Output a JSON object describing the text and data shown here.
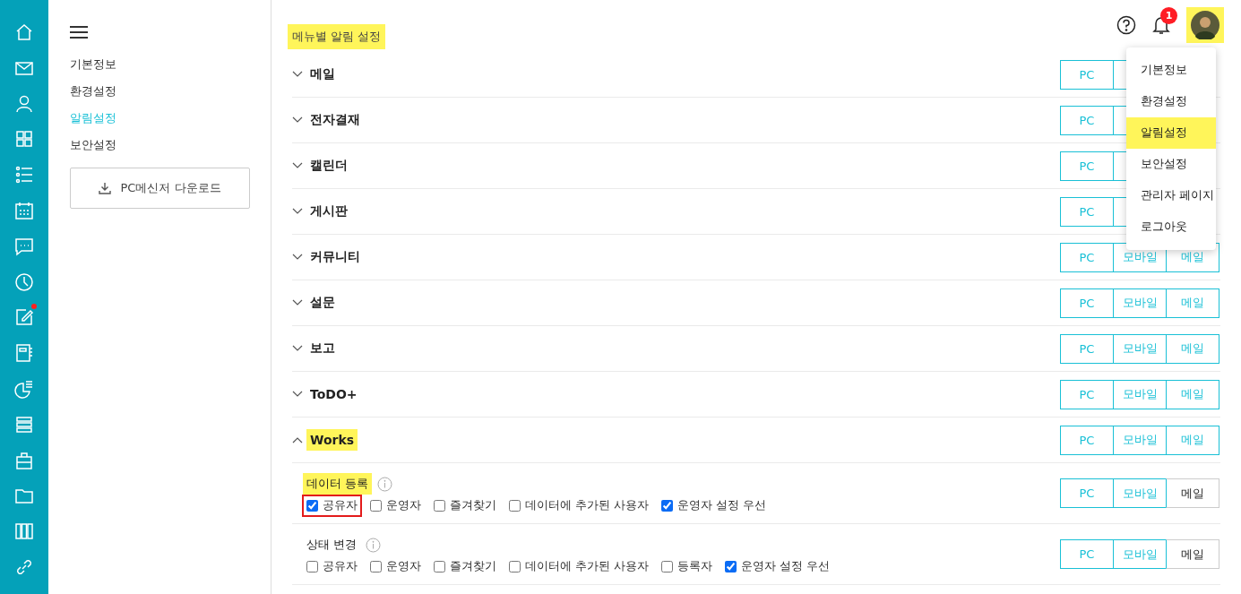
{
  "rail": [
    {
      "dot": false
    },
    {
      "dot": false
    },
    {
      "dot": false
    },
    {
      "dot": false
    },
    {
      "dot": false
    },
    {
      "dot": false
    },
    {
      "dot": false
    },
    {
      "dot": false
    },
    {
      "dot": true
    },
    {
      "dot": false
    },
    {
      "dot": false
    },
    {
      "dot": false
    },
    {
      "dot": false
    },
    {
      "dot": false
    },
    {
      "dot": false
    },
    {
      "dot": false
    }
  ],
  "sidebar": {
    "items": [
      {
        "label": "기본정보",
        "selected": false
      },
      {
        "label": "환경설정",
        "selected": false
      },
      {
        "label": "알림설정",
        "selected": true
      },
      {
        "label": "보안설정",
        "selected": false
      }
    ],
    "download_button": "PC메신저 다운로드"
  },
  "page_title": {
    "text": "메뉴별 알림 설정",
    "highlighted": true
  },
  "header": {
    "badge": "1",
    "avatar_highlighted": true
  },
  "sections": [
    {
      "name": "메일",
      "expanded": false,
      "highlighted": false,
      "channels": [
        {
          "label": "PC",
          "selected": true
        },
        {
          "selected": true
        }
      ]
    },
    {
      "name": "전자결재",
      "expanded": false,
      "highlighted": false,
      "channels": [
        {
          "label": "PC",
          "selected": true
        },
        {
          "selected": true
        }
      ]
    },
    {
      "name": "캘린더",
      "expanded": false,
      "highlighted": false,
      "channels": [
        {
          "label": "PC",
          "selected": true
        },
        {
          "selected": true
        }
      ]
    },
    {
      "name": "게시판",
      "expanded": false,
      "highlighted": false,
      "channels": [
        {
          "label": "PC",
          "selected": true
        },
        {
          "selected": true
        }
      ]
    },
    {
      "name": "커뮤니티",
      "expanded": false,
      "highlighted": false,
      "channels": [
        {
          "label": "PC",
          "selected": true
        },
        {
          "label": "모바일",
          "selected": true
        },
        {
          "label": "메일",
          "selected": true
        }
      ]
    },
    {
      "name": "설문",
      "expanded": false,
      "highlighted": false,
      "channels": [
        {
          "label": "PC",
          "selected": true
        },
        {
          "label": "모바일",
          "selected": true
        },
        {
          "label": "메일",
          "selected": true
        }
      ]
    },
    {
      "name": "보고",
      "expanded": false,
      "highlighted": false,
      "channels": [
        {
          "label": "PC",
          "selected": true
        },
        {
          "label": "모바일",
          "selected": true
        },
        {
          "label": "메일",
          "selected": true
        }
      ]
    },
    {
      "name": "ToDO+",
      "expanded": false,
      "highlighted": false,
      "channels": [
        {
          "label": "PC",
          "selected": true
        },
        {
          "label": "모바일",
          "selected": true
        },
        {
          "label": "메일",
          "selected": true
        }
      ]
    },
    {
      "name": "Works",
      "expanded": true,
      "highlighted": true,
      "channels": [
        {
          "label": "PC",
          "selected": true
        },
        {
          "label": "모바일",
          "selected": true
        },
        {
          "label": "메일",
          "selected": true
        }
      ],
      "children": [
        {
          "name": "데이터 등록",
          "highlighted": true,
          "channels": [
            {
              "label": "PC",
              "selected": true
            },
            {
              "label": "모바일",
              "selected": true
            },
            {
              "label": "메일",
              "selected": false
            }
          ],
          "options": [
            {
              "label": "공유자",
              "checked": true,
              "outlined": true
            },
            {
              "label": "운영자",
              "checked": false,
              "outlined": false
            },
            {
              "label": "즐겨찾기",
              "checked": false,
              "outlined": false
            },
            {
              "label": "데이터에 추가된 사용자",
              "checked": false,
              "outlined": false
            },
            {
              "label": "운영자 설정 우선",
              "checked": true,
              "outlined": false
            }
          ]
        },
        {
          "name": "상태 변경",
          "highlighted": false,
          "channels": [
            {
              "label": "PC",
              "selected": true
            },
            {
              "label": "모바일",
              "selected": true
            },
            {
              "label": "메일",
              "selected": false
            }
          ],
          "options": [
            {
              "label": "공유자",
              "checked": false,
              "outlined": false
            },
            {
              "label": "운영자",
              "checked": false,
              "outlined": false
            },
            {
              "label": "즐겨찾기",
              "checked": false,
              "outlined": false
            },
            {
              "label": "데이터에 추가된 사용자",
              "checked": false,
              "outlined": false
            },
            {
              "label": "등록자",
              "checked": false,
              "outlined": false
            },
            {
              "label": "운영자 설정 우선",
              "checked": true,
              "outlined": false
            }
          ]
        }
      ]
    }
  ],
  "user_menu": {
    "items": [
      {
        "label": "기본정보",
        "highlighted": false
      },
      {
        "label": "환경설정",
        "highlighted": false
      },
      {
        "label": "알림설정",
        "highlighted": true
      },
      {
        "label": "보안설정",
        "highlighted": false
      },
      {
        "label": "관리자 페이지",
        "highlighted": false
      },
      {
        "label": "로그아웃",
        "highlighted": false
      }
    ]
  }
}
